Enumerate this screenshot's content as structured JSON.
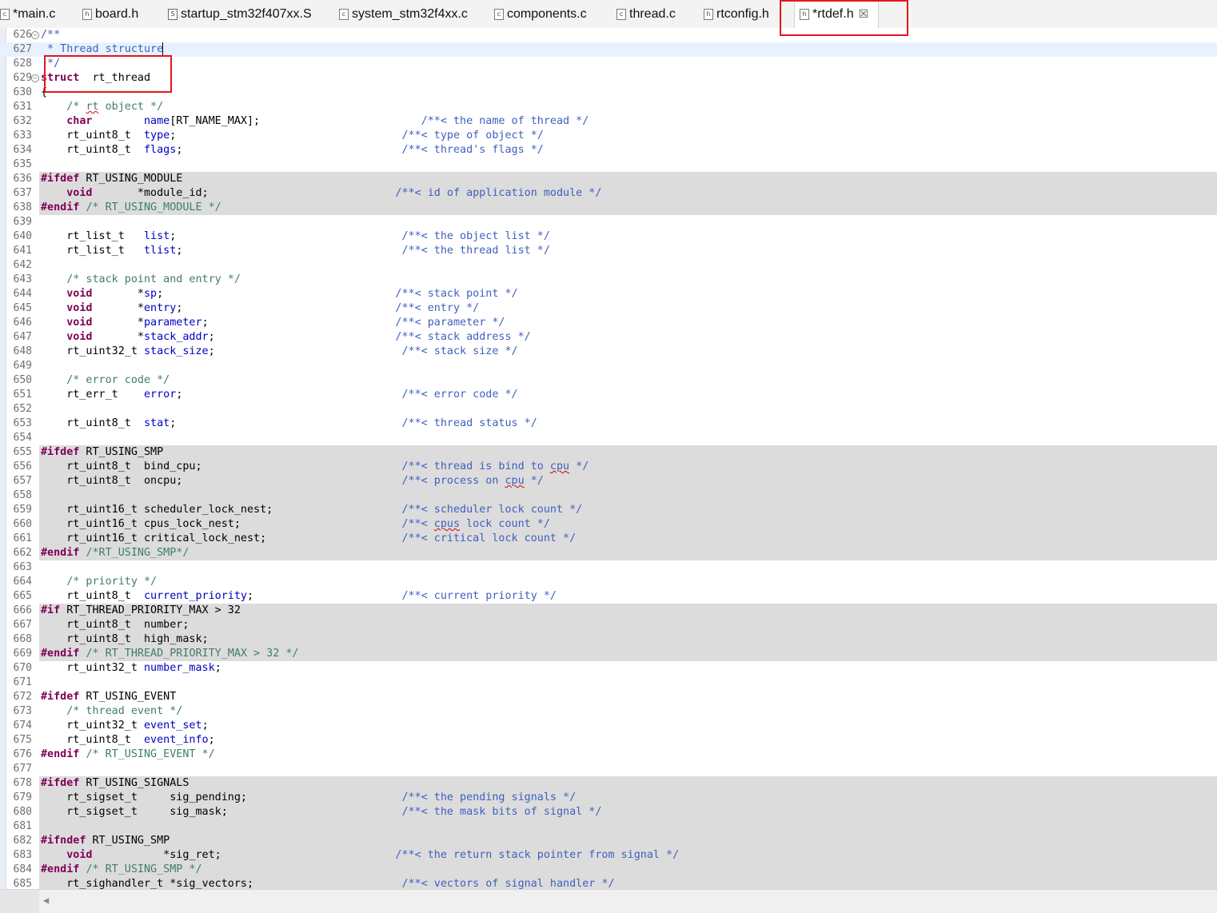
{
  "tabs": [
    {
      "label": "*main.c",
      "icon": "c-file-icon",
      "icon_glyph": "c"
    },
    {
      "label": "board.h",
      "icon": "h-file-icon",
      "icon_glyph": "h"
    },
    {
      "label": "startup_stm32f407xx.S",
      "icon": "s-file-icon",
      "icon_glyph": "S"
    },
    {
      "label": "system_stm32f4xx.c",
      "icon": "c-file-icon",
      "icon_glyph": "c"
    },
    {
      "label": "components.c",
      "icon": "c-file-icon",
      "icon_glyph": "c"
    },
    {
      "label": "thread.c",
      "icon": "c-file-icon",
      "icon_glyph": "c"
    },
    {
      "label": "rtconfig.h",
      "icon": "h-file-icon",
      "icon_glyph": "h"
    },
    {
      "label": "*rtdef.h",
      "icon": "h-file-icon",
      "icon_glyph": "h",
      "active": true
    }
  ],
  "close_glyph": "☒",
  "fold_glyph": "−",
  "scroll_left_glyph": "◀",
  "colors": {
    "keyword": "#7f0055",
    "comment": "#3f7f5f",
    "doc_comment": "#3f5fbf",
    "field": "#0000c0",
    "highlight_box": "#e4161c",
    "inactive_bg": "#dcdcdc"
  },
  "lines": [
    {
      "n": "626",
      "fold": true,
      "tokens": [
        [
          "dc",
          "/**"
        ]
      ]
    },
    {
      "n": "627",
      "hl": true,
      "tokens": [
        [
          "dc",
          " * Thread structure"
        ]
      ]
    },
    {
      "n": "628",
      "tokens": [
        [
          "dc",
          " */"
        ]
      ]
    },
    {
      "n": "629",
      "fold": true,
      "tokens": [
        [
          "kw",
          "struct"
        ],
        [
          "",
          "  rt_thread"
        ]
      ]
    },
    {
      "n": "630",
      "tokens": [
        [
          "",
          "{"
        ]
      ]
    },
    {
      "n": "631",
      "tokens": [
        [
          "",
          "    "
        ],
        [
          "cm",
          "/* "
        ],
        [
          "cm sq",
          "rt"
        ],
        [
          "cm",
          " object */"
        ]
      ]
    },
    {
      "n": "632",
      "tokens": [
        [
          "",
          "    "
        ],
        [
          "kw",
          "char"
        ],
        [
          "",
          "        "
        ],
        [
          "fd",
          "name"
        ],
        [
          "",
          "[RT_NAME_MAX];                         "
        ],
        [
          "dc",
          "/**< the name of thread */"
        ]
      ]
    },
    {
      "n": "633",
      "tokens": [
        [
          "",
          "    rt_uint8_t  "
        ],
        [
          "fd",
          "type"
        ],
        [
          "",
          ";                                   "
        ],
        [
          "dc",
          "/**< type of object */"
        ]
      ]
    },
    {
      "n": "634",
      "tokens": [
        [
          "",
          "    rt_uint8_t  "
        ],
        [
          "fd",
          "flags"
        ],
        [
          "",
          ";                                  "
        ],
        [
          "dc",
          "/**< thread's flags */"
        ]
      ]
    },
    {
      "n": "635",
      "tokens": []
    },
    {
      "n": "636",
      "inactive": true,
      "tokens": [
        [
          "kw",
          "#ifdef"
        ],
        [
          "",
          " RT_USING_MODULE"
        ]
      ]
    },
    {
      "n": "637",
      "inactive": true,
      "tokens": [
        [
          "",
          "    "
        ],
        [
          "kw",
          "void"
        ],
        [
          "",
          "       *module_id;                             "
        ],
        [
          "dc",
          "/**< id of application module */"
        ]
      ]
    },
    {
      "n": "638",
      "inactive": true,
      "tokens": [
        [
          "kw",
          "#endif"
        ],
        [
          "",
          " "
        ],
        [
          "cm",
          "/* RT_USING_MODULE */"
        ]
      ]
    },
    {
      "n": "639",
      "tokens": []
    },
    {
      "n": "640",
      "tokens": [
        [
          "",
          "    rt_list_t   "
        ],
        [
          "fd",
          "list"
        ],
        [
          "",
          ";                                   "
        ],
        [
          "dc",
          "/**< the object list */"
        ]
      ]
    },
    {
      "n": "641",
      "tokens": [
        [
          "",
          "    rt_list_t   "
        ],
        [
          "fd",
          "tlist"
        ],
        [
          "",
          ";                                  "
        ],
        [
          "dc",
          "/**< the thread list */"
        ]
      ]
    },
    {
      "n": "642",
      "tokens": []
    },
    {
      "n": "643",
      "tokens": [
        [
          "",
          "    "
        ],
        [
          "cm",
          "/* stack point and entry */"
        ]
      ]
    },
    {
      "n": "644",
      "tokens": [
        [
          "",
          "    "
        ],
        [
          "kw",
          "void"
        ],
        [
          "",
          "       *"
        ],
        [
          "fd",
          "sp"
        ],
        [
          "",
          ";                                    "
        ],
        [
          "dc",
          "/**< stack point */"
        ]
      ]
    },
    {
      "n": "645",
      "tokens": [
        [
          "",
          "    "
        ],
        [
          "kw",
          "void"
        ],
        [
          "",
          "       *"
        ],
        [
          "fd",
          "entry"
        ],
        [
          "",
          ";                                 "
        ],
        [
          "dc",
          "/**< entry */"
        ]
      ]
    },
    {
      "n": "646",
      "tokens": [
        [
          "",
          "    "
        ],
        [
          "kw",
          "void"
        ],
        [
          "",
          "       *"
        ],
        [
          "fd",
          "parameter"
        ],
        [
          "",
          ";                             "
        ],
        [
          "dc",
          "/**< parameter */"
        ]
      ]
    },
    {
      "n": "647",
      "tokens": [
        [
          "",
          "    "
        ],
        [
          "kw",
          "void"
        ],
        [
          "",
          "       *"
        ],
        [
          "fd",
          "stack_addr"
        ],
        [
          "",
          ";                            "
        ],
        [
          "dc",
          "/**< stack address */"
        ]
      ]
    },
    {
      "n": "648",
      "tokens": [
        [
          "",
          "    rt_uint32_t "
        ],
        [
          "fd",
          "stack_size"
        ],
        [
          "",
          ";                             "
        ],
        [
          "dc",
          "/**< stack size */"
        ]
      ]
    },
    {
      "n": "649",
      "tokens": []
    },
    {
      "n": "650",
      "tokens": [
        [
          "",
          "    "
        ],
        [
          "cm",
          "/* error code */"
        ]
      ]
    },
    {
      "n": "651",
      "tokens": [
        [
          "",
          "    rt_err_t    "
        ],
        [
          "fd",
          "error"
        ],
        [
          "",
          ";                                  "
        ],
        [
          "dc",
          "/**< error code */"
        ]
      ]
    },
    {
      "n": "652",
      "tokens": []
    },
    {
      "n": "653",
      "tokens": [
        [
          "",
          "    rt_uint8_t  "
        ],
        [
          "fd",
          "stat"
        ],
        [
          "",
          ";                                   "
        ],
        [
          "dc",
          "/**< thread status */"
        ]
      ]
    },
    {
      "n": "654",
      "tokens": []
    },
    {
      "n": "655",
      "inactive": true,
      "tokens": [
        [
          "kw",
          "#ifdef"
        ],
        [
          "",
          " RT_USING_SMP"
        ]
      ]
    },
    {
      "n": "656",
      "inactive": true,
      "tokens": [
        [
          "",
          "    rt_uint8_t  bind_cpu;                               "
        ],
        [
          "dc",
          "/**< thread is bind to "
        ],
        [
          "dc sq",
          "cpu"
        ],
        [
          "dc",
          " */"
        ]
      ]
    },
    {
      "n": "657",
      "inactive": true,
      "tokens": [
        [
          "",
          "    rt_uint8_t  oncpu;                                  "
        ],
        [
          "dc",
          "/**< process on "
        ],
        [
          "dc sq",
          "cpu"
        ],
        [
          "dc",
          " */"
        ]
      ]
    },
    {
      "n": "658",
      "inactive": true,
      "tokens": []
    },
    {
      "n": "659",
      "inactive": true,
      "tokens": [
        [
          "",
          "    rt_uint16_t scheduler_lock_nest;                    "
        ],
        [
          "dc",
          "/**< scheduler lock count */"
        ]
      ]
    },
    {
      "n": "660",
      "inactive": true,
      "tokens": [
        [
          "",
          "    rt_uint16_t cpus_lock_nest;                         "
        ],
        [
          "dc",
          "/**< "
        ],
        [
          "dc sq",
          "cpus"
        ],
        [
          "dc",
          " lock count */"
        ]
      ]
    },
    {
      "n": "661",
      "inactive": true,
      "tokens": [
        [
          "",
          "    rt_uint16_t critical_lock_nest;                     "
        ],
        [
          "dc",
          "/**< critical lock count */"
        ]
      ]
    },
    {
      "n": "662",
      "inactive": true,
      "tokens": [
        [
          "kw",
          "#endif"
        ],
        [
          "",
          " "
        ],
        [
          "cm",
          "/*RT_USING_SMP*/"
        ]
      ]
    },
    {
      "n": "663",
      "tokens": []
    },
    {
      "n": "664",
      "tokens": [
        [
          "",
          "    "
        ],
        [
          "cm",
          "/* priority */"
        ]
      ]
    },
    {
      "n": "665",
      "tokens": [
        [
          "",
          "    rt_uint8_t  "
        ],
        [
          "fd",
          "current_priority"
        ],
        [
          "",
          ";                       "
        ],
        [
          "dc",
          "/**< current priority */"
        ]
      ]
    },
    {
      "n": "666",
      "inactive": true,
      "tokens": [
        [
          "kw",
          "#if"
        ],
        [
          "",
          " RT_THREAD_PRIORITY_MAX > 32"
        ]
      ]
    },
    {
      "n": "667",
      "inactive": true,
      "tokens": [
        [
          "",
          "    rt_uint8_t  number;"
        ]
      ]
    },
    {
      "n": "668",
      "inactive": true,
      "tokens": [
        [
          "",
          "    rt_uint8_t  high_mask;"
        ]
      ]
    },
    {
      "n": "669",
      "inactive": true,
      "tokens": [
        [
          "kw",
          "#endif"
        ],
        [
          "",
          " "
        ],
        [
          "cm",
          "/* RT_THREAD_PRIORITY_MAX > 32 */"
        ]
      ]
    },
    {
      "n": "670",
      "tokens": [
        [
          "",
          "    rt_uint32_t "
        ],
        [
          "fd",
          "number_mask"
        ],
        [
          "",
          ";"
        ]
      ]
    },
    {
      "n": "671",
      "tokens": []
    },
    {
      "n": "672",
      "tokens": [
        [
          "kw",
          "#ifdef"
        ],
        [
          "",
          " RT_USING_EVENT"
        ]
      ]
    },
    {
      "n": "673",
      "tokens": [
        [
          "",
          "    "
        ],
        [
          "cm",
          "/* thread event */"
        ]
      ]
    },
    {
      "n": "674",
      "tokens": [
        [
          "",
          "    rt_uint32_t "
        ],
        [
          "fd",
          "event_set"
        ],
        [
          "",
          ";"
        ]
      ]
    },
    {
      "n": "675",
      "tokens": [
        [
          "",
          "    rt_uint8_t  "
        ],
        [
          "fd",
          "event_info"
        ],
        [
          "",
          ";"
        ]
      ]
    },
    {
      "n": "676",
      "tokens": [
        [
          "kw",
          "#endif"
        ],
        [
          "",
          " "
        ],
        [
          "cm",
          "/* RT_USING_EVENT */"
        ]
      ]
    },
    {
      "n": "677",
      "tokens": []
    },
    {
      "n": "678",
      "inactive": true,
      "tokens": [
        [
          "kw",
          "#ifdef"
        ],
        [
          "",
          " RT_USING_SIGNALS"
        ]
      ]
    },
    {
      "n": "679",
      "inactive": true,
      "tokens": [
        [
          "",
          "    rt_sigset_t     sig_pending;                        "
        ],
        [
          "dc",
          "/**< the pending signals */"
        ]
      ]
    },
    {
      "n": "680",
      "inactive": true,
      "tokens": [
        [
          "",
          "    rt_sigset_t     sig_mask;                           "
        ],
        [
          "dc",
          "/**< the mask bits of signal */"
        ]
      ]
    },
    {
      "n": "681",
      "inactive": true,
      "tokens": []
    },
    {
      "n": "682",
      "inactive": true,
      "tokens": [
        [
          "kw",
          "#ifndef"
        ],
        [
          "",
          " RT_USING_SMP"
        ]
      ]
    },
    {
      "n": "683",
      "inactive": true,
      "tokens": [
        [
          "",
          "    "
        ],
        [
          "kw",
          "void"
        ],
        [
          "",
          "           *sig_ret;                           "
        ],
        [
          "dc",
          "/**< the return stack pointer from signal */"
        ]
      ]
    },
    {
      "n": "684",
      "inactive": true,
      "tokens": [
        [
          "kw",
          "#endif"
        ],
        [
          "",
          " "
        ],
        [
          "cm",
          "/* RT_USING_SMP */"
        ]
      ]
    },
    {
      "n": "685",
      "inactive": true,
      "tokens": [
        [
          "",
          "    rt_sighandler_t *sig_vectors;                       "
        ],
        [
          "dc",
          "/**< vectors of signal handler */"
        ]
      ]
    }
  ]
}
